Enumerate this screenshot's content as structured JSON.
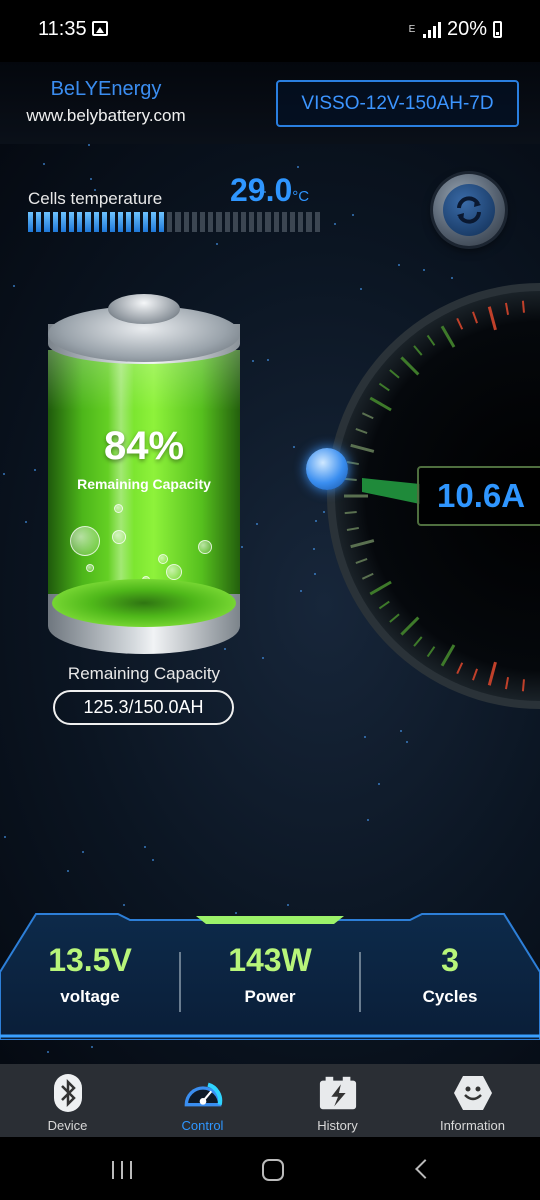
{
  "status_bar": {
    "time": "11:35",
    "network_label": "E",
    "battery_percent": "20%"
  },
  "header": {
    "brand_name": "BeLYEnergy",
    "brand_url": "www.belybattery.com",
    "device_name": "VISSO-12V-150AH-7D"
  },
  "temperature": {
    "label": "Cells temperature",
    "value": "29.0",
    "unit": "°C",
    "bar_fill_fraction": 0.46
  },
  "battery": {
    "percent": "84%",
    "caption": "Remaining Capacity",
    "level_fraction": 0.84
  },
  "capacity": {
    "label": "Remaining Capacity",
    "value": "125.3/150.0AH"
  },
  "current": {
    "value": "10.6A"
  },
  "stats": [
    {
      "value": "13.5V",
      "label": "voltage"
    },
    {
      "value": "143W",
      "label": "Power"
    },
    {
      "value": "3",
      "label": "Cycles"
    }
  ],
  "nav": [
    {
      "label": "Device",
      "icon": "bluetooth-icon"
    },
    {
      "label": "Control",
      "icon": "speedometer-icon",
      "active": true
    },
    {
      "label": "History",
      "icon": "battery-history-icon"
    },
    {
      "label": "Information",
      "icon": "smiley-icon"
    }
  ],
  "colors": {
    "accent_blue": "#2f96ff",
    "stat_green": "#b8f57a",
    "battery_green": "#74e02b"
  }
}
